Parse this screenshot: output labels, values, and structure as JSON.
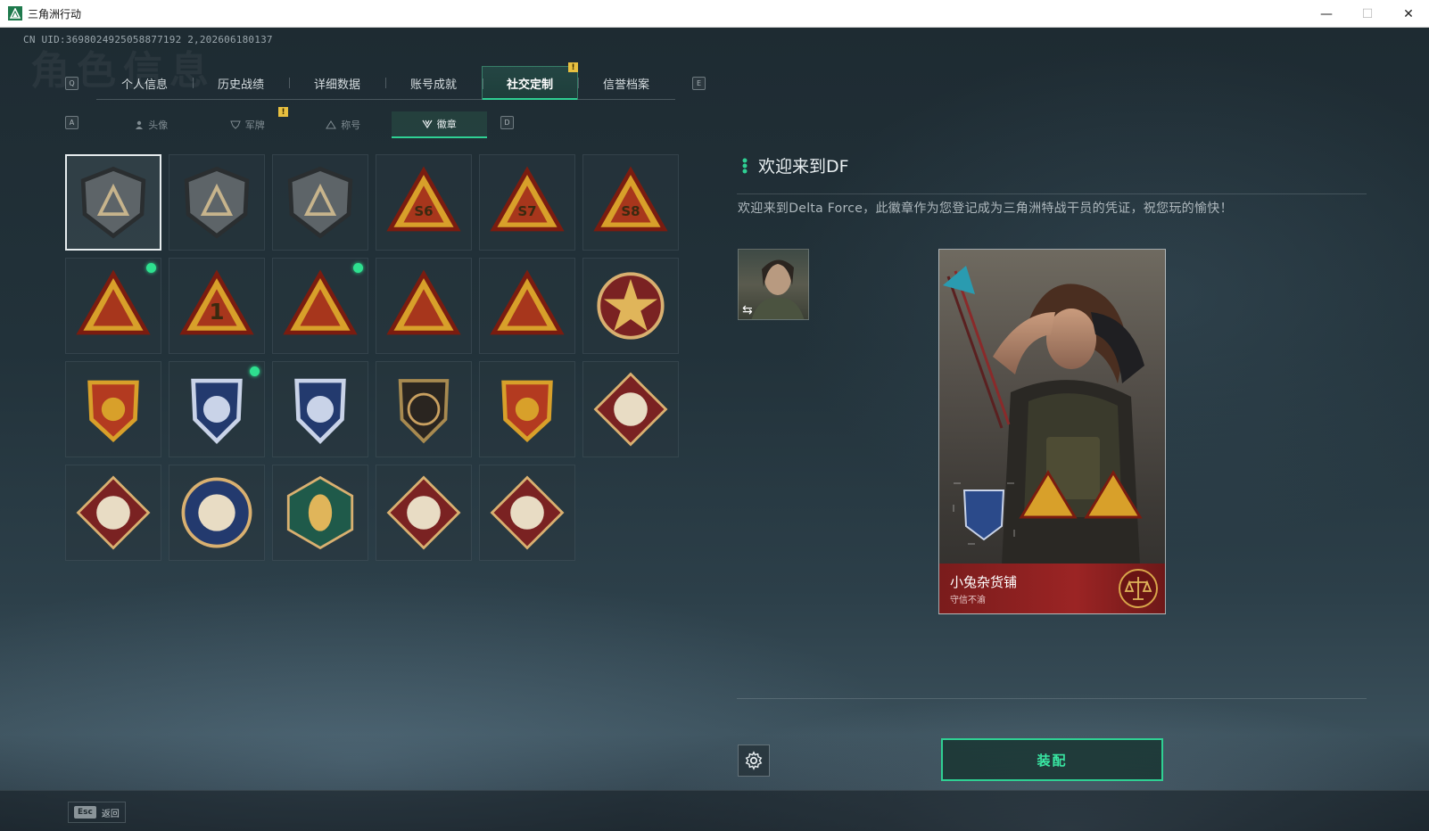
{
  "window": {
    "title": "三角洲行动",
    "controls": [
      "—",
      "☐",
      "✕"
    ]
  },
  "uid_text": "CN UID:3698024925058877192 2,202606180137",
  "watermark": "角色信息",
  "main_tabs": {
    "left_key": "Q",
    "right_key": "E",
    "items": [
      {
        "label": "个人信息"
      },
      {
        "label": "历史战绩"
      },
      {
        "label": "详细数据"
      },
      {
        "label": "账号成就"
      },
      {
        "label": "社交定制",
        "active": true,
        "notice": "!"
      },
      {
        "label": "信誉档案"
      }
    ]
  },
  "sub_tabs": {
    "left_key": "A",
    "right_key": "D",
    "items": [
      {
        "label": "头像",
        "icon": "person-icon"
      },
      {
        "label": "军牌",
        "icon": "dogtag-icon",
        "notice": "!"
      },
      {
        "label": "称号",
        "icon": "title-icon"
      },
      {
        "label": "徽章",
        "icon": "badge-icon",
        "active": true
      }
    ]
  },
  "badges": [
    {
      "name": "delta-gray-shield",
      "selected": true,
      "new": false
    },
    {
      "name": "helicopter-shield",
      "new": false
    },
    {
      "name": "diamond-shield",
      "new": false
    },
    {
      "name": "s6-triangle",
      "text": "S6",
      "new": false
    },
    {
      "name": "s7-triangle",
      "text": "S7",
      "new": false
    },
    {
      "name": "s8-triangle",
      "text": "S8",
      "new": false
    },
    {
      "name": "hands-triangle",
      "new": true
    },
    {
      "name": "number-one-triangle",
      "text": "1",
      "new": false
    },
    {
      "name": "usb-triangle",
      "new": true
    },
    {
      "name": "globe-triangle",
      "new": false
    },
    {
      "name": "soldiers-triangle",
      "new": false
    },
    {
      "name": "star-medal",
      "new": false
    },
    {
      "name": "red-shield-stars",
      "new": false
    },
    {
      "name": "blue-gem-shield",
      "new": true
    },
    {
      "name": "rifle-crosshair-blue",
      "new": false
    },
    {
      "name": "pistol-shield",
      "new": false
    },
    {
      "name": "rifle-crosshair-gold",
      "new": false
    },
    {
      "name": "wolf-diamond",
      "new": false
    },
    {
      "name": "wolf-diamond-red",
      "new": false
    },
    {
      "name": "eagle-circle",
      "new": false
    },
    {
      "name": "wasp-hexagon",
      "new": false
    },
    {
      "name": "dragon-diamond",
      "new": false
    },
    {
      "name": "runner-diamond",
      "new": false
    }
  ],
  "detail": {
    "title": "欢迎来到DF",
    "description": "欢迎来到Delta Force，此徽章作为您登记成为三角洲特战干员的凭证，祝您玩的愉快！",
    "card_name": "小兔杂货铺",
    "card_subtitle": "守信不渝",
    "equip_label": "装配"
  },
  "bottom": {
    "esc_key": "Esc",
    "back_label": "返回"
  },
  "colors": {
    "accent": "#2fd093",
    "notice": "#e8c040",
    "new_dot": "#2ee08f",
    "card_red": "#9b2424"
  }
}
